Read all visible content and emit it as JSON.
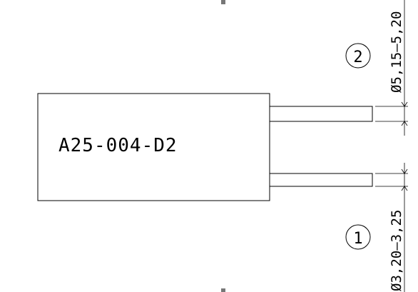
{
  "drawing": {
    "part_number": "A25-004-D2",
    "callout_2": "2",
    "callout_1": "1",
    "dim_top": "Ø5,15–5,20",
    "dim_bottom": "Ø3,20–3,25"
  }
}
